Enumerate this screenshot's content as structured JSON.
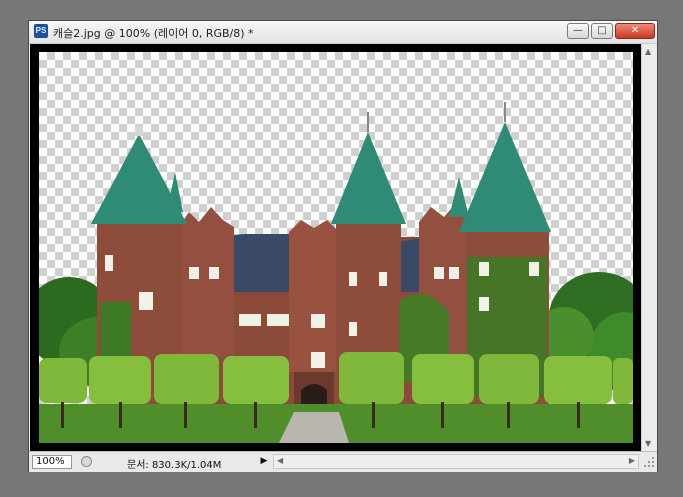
{
  "window": {
    "app_icon": "PS",
    "title": "캐슬2.jpg @ 100% (레이어 0, RGB/8) *",
    "buttons": {
      "minimize": "minimize-icon",
      "maximize": "maximize-icon",
      "close": "close-icon"
    }
  },
  "canvas": {
    "image_name": "castle-photo"
  },
  "status": {
    "zoom": "100%",
    "doc_info": "문서: 830.3K/1.04M",
    "menu_arrow": "▶"
  },
  "colors": {
    "workspace": "#777777",
    "roof": "#2f8a76",
    "brick": "#8b4a3a",
    "hedge": "#7fb83a"
  }
}
